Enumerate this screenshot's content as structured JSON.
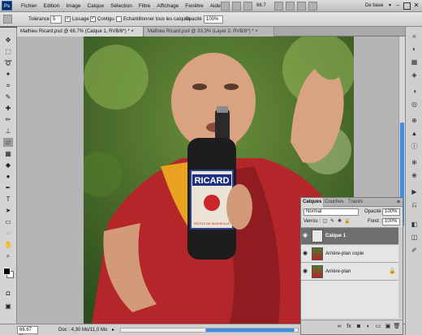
{
  "app": {
    "logo": "Ps"
  },
  "menu": [
    "Fichier",
    "Edition",
    "Image",
    "Calque",
    "Sélection",
    "Filtre",
    "Affichage",
    "Fenêtre",
    "Aide"
  ],
  "menubar": {
    "zoom": "66.7",
    "workspace": "De base",
    "workspace_arrow": "▾",
    "minimize": "–",
    "close": "✕"
  },
  "options": {
    "tolerance_label": "Tolérance :",
    "tolerance_value": "5",
    "lissage_label": "Lissage",
    "contigu_label": "Contigu",
    "echantillon_label": "Echantillonner tous les calques",
    "opacity_label": "Opacité :",
    "opacity_value": "100%"
  },
  "tabs": [
    {
      "label": "Mathieu Ricard.psd @ 66,7% (Calque 1, RVB/8*) *  ×"
    },
    {
      "label": "Mathieu Ricard.psd @ 33,3% (Layer 2, RVB/8*) *  ×"
    }
  ],
  "photo": {
    "bottle_brand": "RICARD",
    "bottle_sub": "PASTIS DE MARSEILLE"
  },
  "status": {
    "zoom": "66.67 %",
    "doc_info": "Doc : 4,30 Mo/11,0 Mo",
    "arrow": "▸"
  },
  "layers_panel": {
    "tabs": [
      "Calques",
      "Couches",
      "Tracés"
    ],
    "menu_icon": "≡",
    "blend_mode": "Normal",
    "opacity_label": "Opacité :",
    "opacity_value": "100%",
    "lock_label": "Verrou :",
    "fill_label": "Fond :",
    "fill_value": "100%",
    "layers": [
      {
        "name": "Calque 1",
        "selected": true
      },
      {
        "name": "Arrière-plan copie",
        "selected": false
      },
      {
        "name": "Arrière-plan",
        "selected": false
      }
    ]
  },
  "colors": {
    "selection": "#6f6f6f",
    "accent": "#3d8fe4",
    "robe": "#b5262b"
  }
}
